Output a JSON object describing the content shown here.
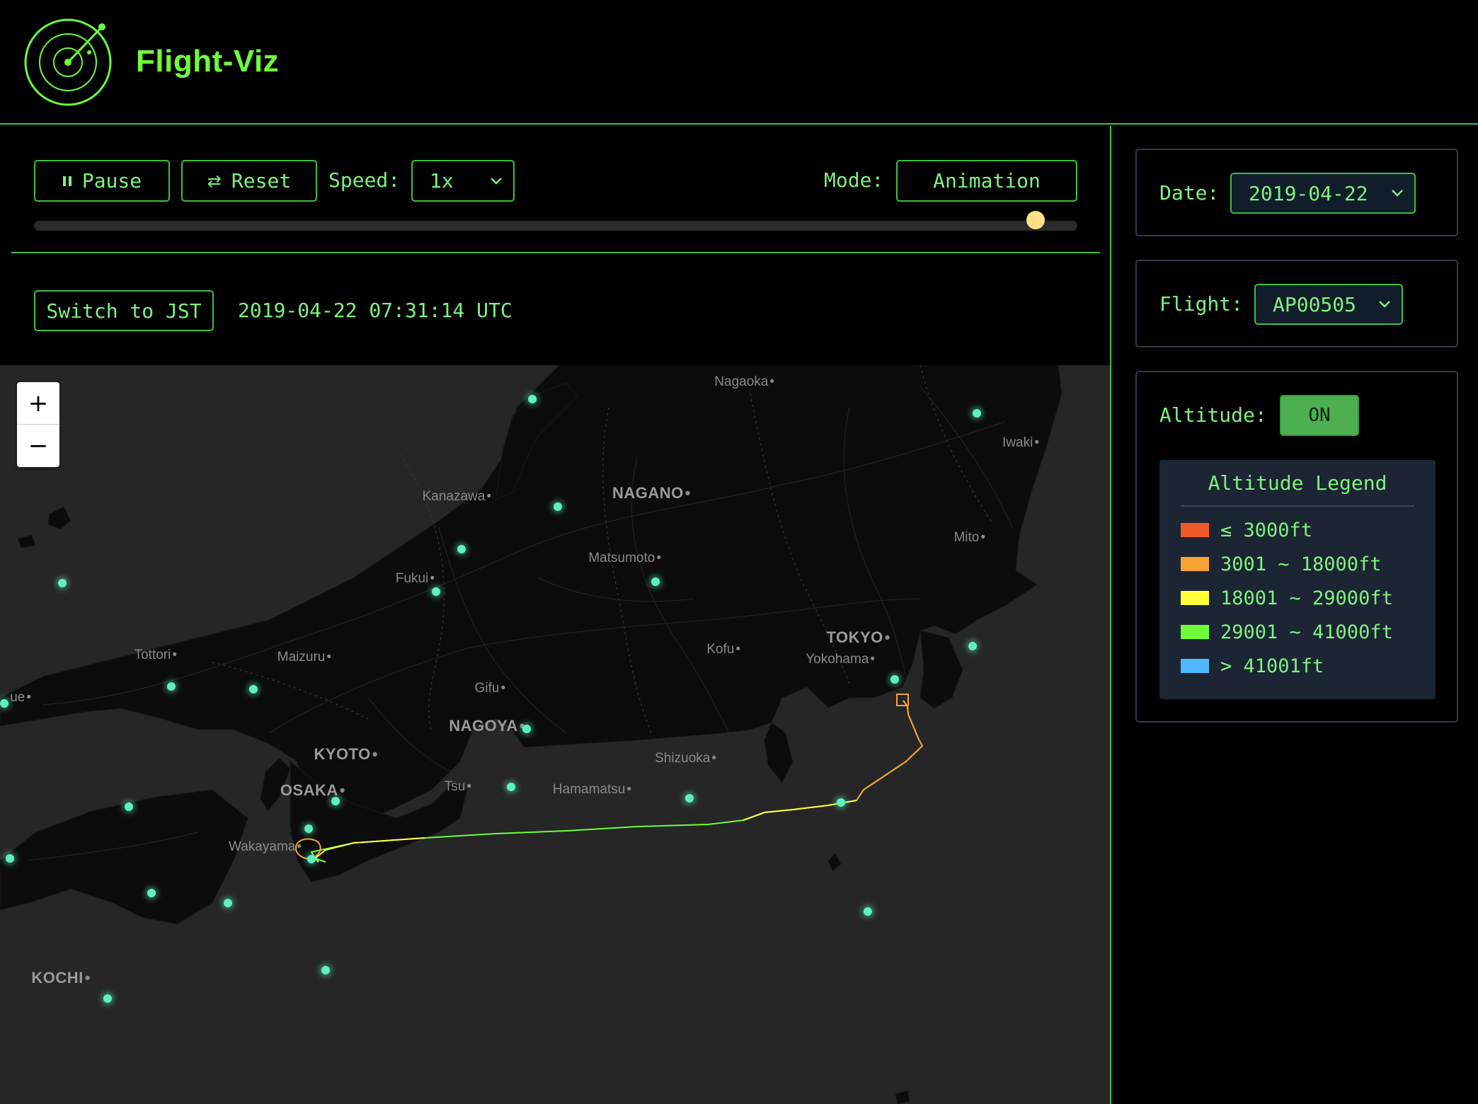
{
  "app": {
    "title": "Flight-Viz"
  },
  "controls": {
    "pause_label": "Pause",
    "reset_label": "Reset",
    "speed_label": "Speed:",
    "speed_value": "1x",
    "mode_label": "Mode:",
    "mode_value": "Animation",
    "playback_progress": 0.96
  },
  "time": {
    "switch_label": "Switch to JST",
    "current": "2019-04-22 07:31:14 UTC"
  },
  "map": {
    "zoom_in": "+",
    "zoom_out": "−",
    "labels": [
      {
        "text": "Nagaoka",
        "big": false
      },
      {
        "text": "Iwaki",
        "big": false
      },
      {
        "text": "Kanazawa",
        "big": false
      },
      {
        "text": "NAGANO",
        "big": true
      },
      {
        "text": "Mito",
        "big": false
      },
      {
        "text": "Matsumoto",
        "big": false
      },
      {
        "text": "Fukui",
        "big": false
      },
      {
        "text": "TOKYO",
        "big": true
      },
      {
        "text": "Kofu",
        "big": false
      },
      {
        "text": "Yokohama",
        "big": false
      },
      {
        "text": "Tottori",
        "big": false
      },
      {
        "text": "Maizuru",
        "big": false
      },
      {
        "text": "Gifu",
        "big": false
      },
      {
        "text": "NAGOYA",
        "big": true
      },
      {
        "text": "KYOTO",
        "big": true
      },
      {
        "text": "Shizuoka",
        "big": false
      },
      {
        "text": "OSAKA",
        "big": true
      },
      {
        "text": "Tsu",
        "big": false
      },
      {
        "text": "Hamamatsu",
        "big": false
      },
      {
        "text": "Wakayama",
        "big": false
      },
      {
        "text": "KOCHI",
        "big": true
      },
      {
        "text": "ue",
        "big": false
      }
    ]
  },
  "sidebar": {
    "date_label": "Date:",
    "date_value": "2019-04-22",
    "flight_label": "Flight:",
    "flight_value": "AP00505",
    "altitude_label": "Altitude:",
    "altitude_toggle": "ON",
    "legend": {
      "title": "Altitude Legend",
      "items": [
        {
          "label": "≤ 3000ft",
          "color": "#f05a28"
        },
        {
          "label": "3001 ~ 18000ft",
          "color": "#f7a233"
        },
        {
          "label": "18001 ~ 29000ft",
          "color": "#ffff3a"
        },
        {
          "label": "29001 ~ 41000ft",
          "color": "#6dff3a"
        },
        {
          "label": "> 41001ft",
          "color": "#4db8ff"
        }
      ]
    }
  },
  "colors": {
    "accent": "#7ff27f",
    "border": "#3fbf3f",
    "airport": "#5ff0c0",
    "slider_thumb": "#ffe08a",
    "toggle_on": "#4caf50"
  }
}
